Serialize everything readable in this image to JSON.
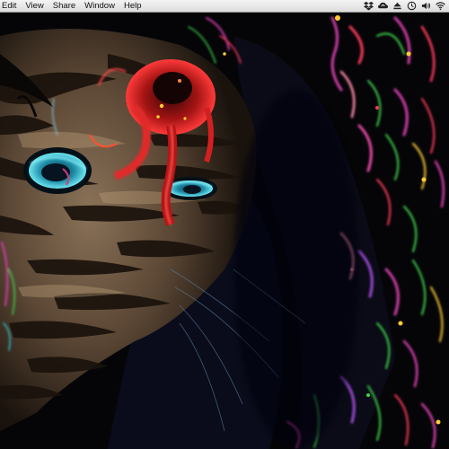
{
  "menubar": {
    "items": [
      {
        "label": "Edit"
      },
      {
        "label": "View"
      },
      {
        "label": "Share"
      },
      {
        "label": "Window"
      },
      {
        "label": "Help"
      }
    ],
    "status_icons": [
      "dropbox-icon",
      "drive-sync-icon",
      "eject-icon",
      "history-icon",
      "volume-icon",
      "wifi-icon"
    ]
  },
  "desktop": {
    "wallpaper": "stylized-tiger-face-artwork",
    "colors": {
      "background": "#050508",
      "tiger_stripe_light": "#b89a78",
      "tiger_stripe_dark": "#1a120c",
      "eye_cyan": "#2fc4d0",
      "red_streak": "#c81818",
      "neon_green": "#3cd24a",
      "neon_magenta": "#d23ca8"
    }
  }
}
